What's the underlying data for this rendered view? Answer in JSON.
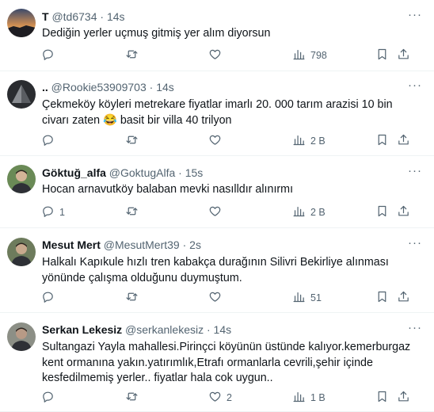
{
  "tweets": [
    {
      "name": "T",
      "handle": "@td6734",
      "sep": "·",
      "time": "14s",
      "text": "Dediğin yerler uçmuş gitmiş yer alım diyorsun",
      "replies": "",
      "retweets": "",
      "likes": "",
      "views": "798",
      "avatar_icon": "sunset-landscape"
    },
    {
      "name": "..",
      "handle": "@Rookie53909703",
      "sep": "·",
      "time": "14s",
      "text": "Çekmeköy köyleri metrekare fiyatlar imarlı 20. 000 tarım arazisi 10 bin civarı zaten 😂 basit bir villa 40 trilyon",
      "replies": "",
      "retweets": "",
      "likes": "",
      "views": "2 B",
      "avatar_icon": "dark-pyramid"
    },
    {
      "name": "Göktuğ_alfa",
      "handle": "@GoktugAlfa",
      "sep": "·",
      "time": "15s",
      "text": "Hocan arnavutköy balaban mevki nasılldır alınırmı",
      "replies": "1",
      "retweets": "",
      "likes": "",
      "views": "2 B",
      "avatar_icon": "person-photo"
    },
    {
      "name": "Mesut Mert",
      "handle": "@MesutMert39",
      "sep": "·",
      "time": "2s",
      "text": "Halkalı Kapıkule hızlı tren kabakça durağının Silivri Bekirliye alınması yönünde çalışma olduğunu duymuştum.",
      "replies": "",
      "retweets": "",
      "likes": "",
      "views": "51",
      "avatar_icon": "person-photo"
    },
    {
      "name": "Serkan Lekesiz",
      "handle": "@serkanlekesiz",
      "sep": "·",
      "time": "14s",
      "text": "Sultangazi Yayla mahallesi.Pirinçci köyünün üstünde kalıyor.kemerburgaz kent ormanına yakın.yatırımlık,Etrafı ormanlarla cevrili,şehir içinde kesfedilmemiş yerler.. fiyatlar hala cok uygun..",
      "replies": "",
      "retweets": "",
      "likes": "2",
      "views": "1 B",
      "avatar_icon": "person-photo"
    }
  ],
  "colors": {
    "text": "#0f1419",
    "muted": "#536471",
    "divider": "#eff3f4"
  }
}
